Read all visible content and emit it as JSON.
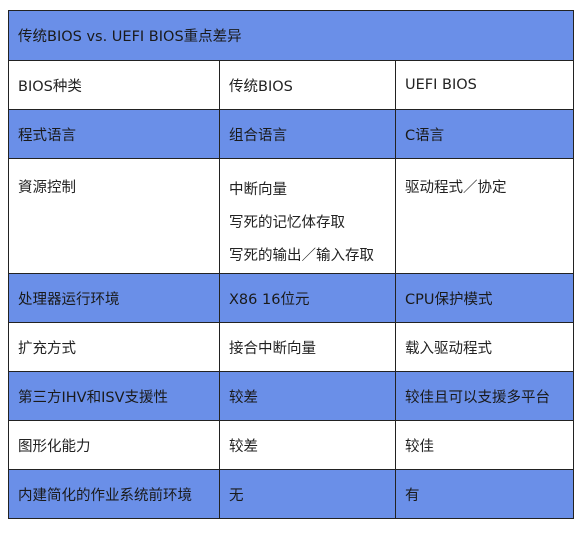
{
  "table": {
    "title": "传统BIOS vs. UEFI BIOS重点差异",
    "header": [
      "BIOS种类",
      "传统BIOS",
      "UEFI BIOS"
    ],
    "rows": [
      [
        "程式语言",
        "组合语言",
        "C语言"
      ],
      [
        "資源控制",
        [
          "中断向量",
          "写死的记忆体存取",
          "写死的输出／输入存取"
        ],
        "驱动程式／协定"
      ],
      [
        "处理器运行环境",
        "X86 16位元",
        "CPU保护模式"
      ],
      [
        "扩充方式",
        "接合中断向量",
        "载入驱动程式"
      ],
      [
        "第三方IHV和ISV支援性",
        "较差",
        "较佳且可以支援多平台"
      ],
      [
        "图形化能力",
        "较差",
        "较佳"
      ],
      [
        "内建简化的作业系统前环境",
        "无",
        "有"
      ]
    ]
  },
  "colors": {
    "accent_blue": "#6a8fe8",
    "border": "#222222",
    "background": "#ffffff"
  }
}
